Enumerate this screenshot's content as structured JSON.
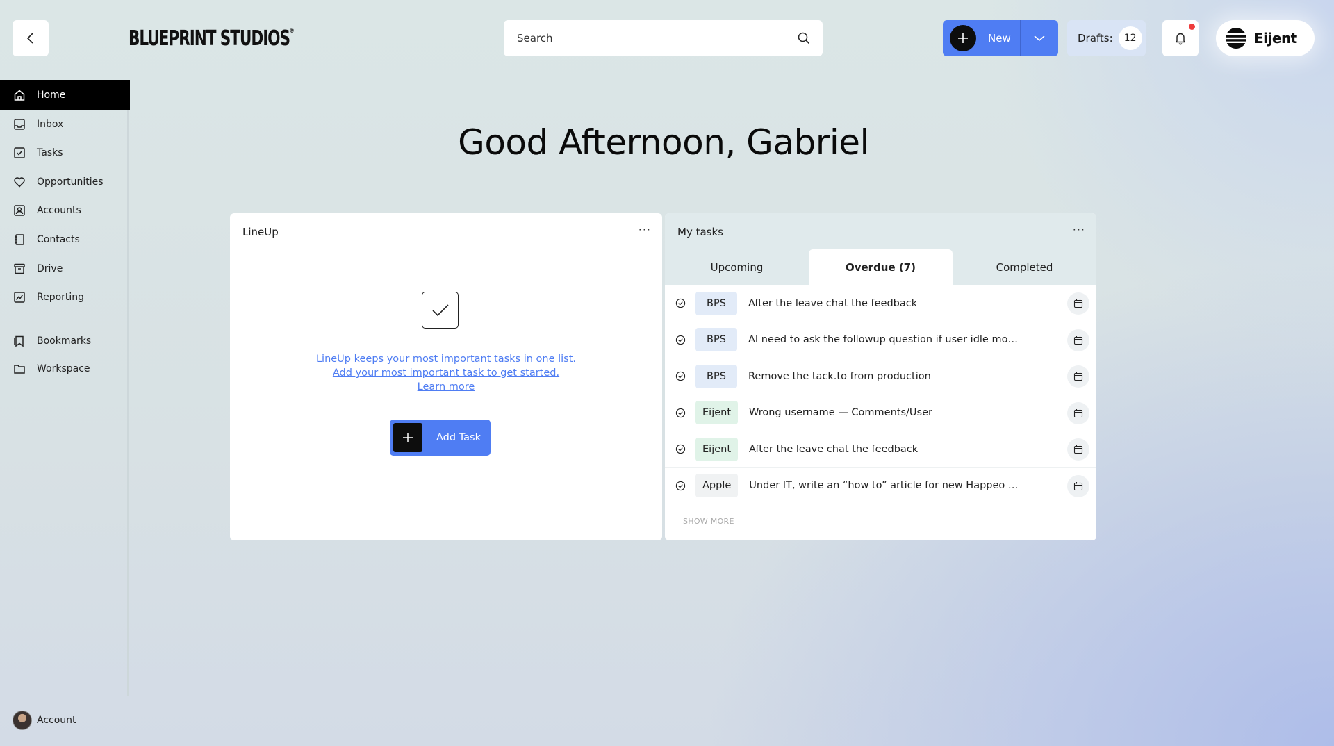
{
  "header": {
    "logo_text": "BLUEPRINT STUDIOS",
    "search_placeholder": "Search",
    "new_label": "New",
    "drafts_label": "Drafts:",
    "drafts_count": "12",
    "brand_name": "Eijent"
  },
  "sidebar": {
    "items": [
      {
        "label": "Home",
        "icon": "home-icon",
        "active": true
      },
      {
        "label": "Inbox",
        "icon": "inbox-icon"
      },
      {
        "label": "Tasks",
        "icon": "checkbox-icon"
      },
      {
        "label": "Opportunities",
        "icon": "heart-icon"
      },
      {
        "label": "Accounts",
        "icon": "user-card-icon"
      },
      {
        "label": "Contacts",
        "icon": "contact-book-icon"
      },
      {
        "label": "Drive",
        "icon": "archive-icon"
      },
      {
        "label": "Reporting",
        "icon": "chart-icon"
      }
    ],
    "secondary": [
      {
        "label": "Bookmarks",
        "icon": "bookmark-icon"
      },
      {
        "label": "Workspace",
        "icon": "folder-icon"
      }
    ],
    "account_label": "Account"
  },
  "greeting": "Good Afternoon, Gabriel",
  "lineup": {
    "title": "LineUp",
    "line1": "LineUp keeps your most important tasks in one list.",
    "line2": "Add your most important task to get started.",
    "learn_more": "Learn more",
    "add_task_label": "Add Task"
  },
  "my_tasks": {
    "title": "My tasks",
    "tabs": [
      "Upcoming",
      "Overdue (7)",
      "Completed"
    ],
    "active_tab": "Overdue (7)",
    "rows": [
      {
        "tag": "BPS",
        "text": "After the leave chat the feedback"
      },
      {
        "tag": "BPS",
        "text": "AI need to ask the followup question if user idle more than..."
      },
      {
        "tag": "BPS",
        "text": "Remove the tack.to from production"
      },
      {
        "tag": "Eijent",
        "text": "Wrong username — Comments/User"
      },
      {
        "tag": "Eijent",
        "text": "After the leave chat the feedback"
      },
      {
        "tag": "Apple",
        "text": "Under IT, write an “how to” article for new Happeo users"
      }
    ],
    "show_more": "SHOW MORE"
  },
  "colors": {
    "accent": "#4f7df3",
    "notification_dot": "#ee3b3b",
    "tag_bps": "#e2ebf8",
    "tag_eijent": "#e0f3e8",
    "tag_apple": "#f0f2f3"
  }
}
